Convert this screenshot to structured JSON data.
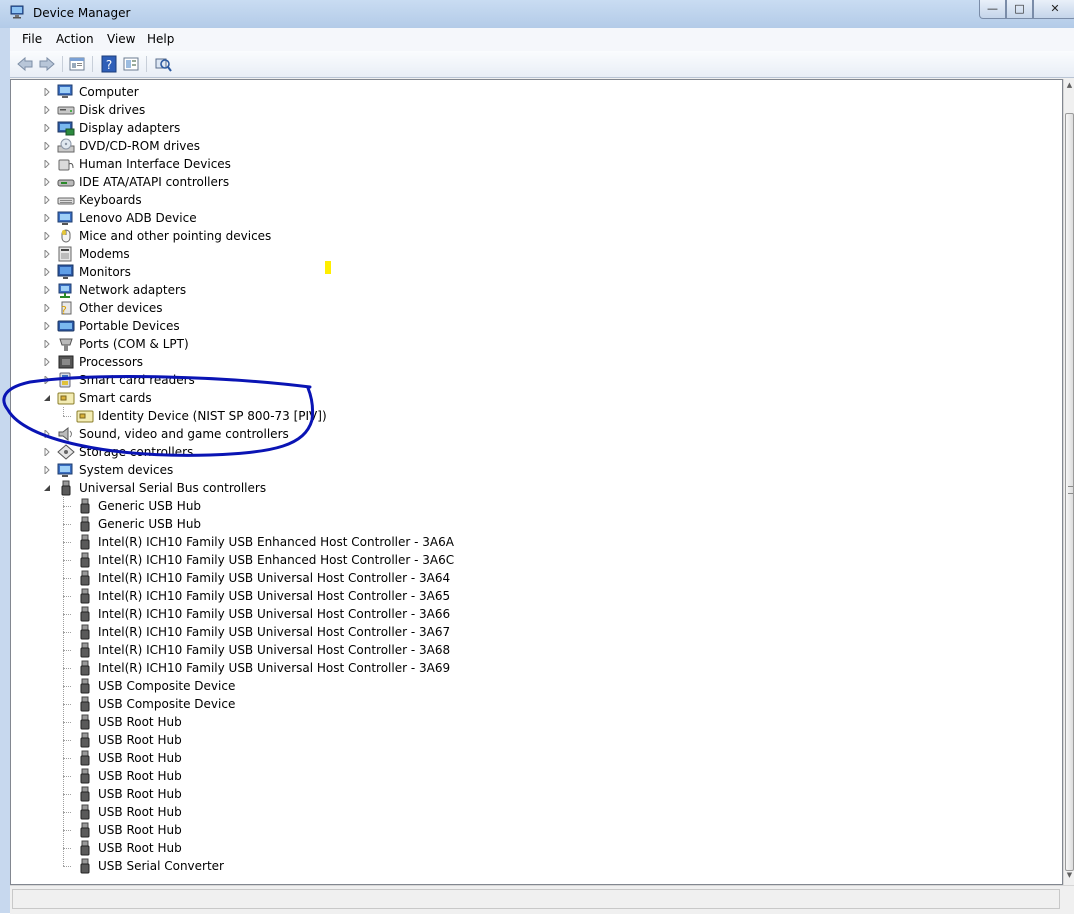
{
  "window": {
    "title": "Device Manager",
    "controls": {
      "minimize": "—",
      "maximize": "□",
      "close": "✕"
    }
  },
  "menu": [
    "File",
    "Action",
    "View",
    "Help"
  ],
  "toolbar": [
    "back-icon",
    "forward-icon",
    "properties-icon",
    "help-icon",
    "view-icon",
    "scan-hardware-icon"
  ],
  "tree": {
    "categories": [
      {
        "label": "Computer",
        "icon": "computer-icon",
        "expanded": false
      },
      {
        "label": "Disk drives",
        "icon": "disk-drive-icon",
        "expanded": false
      },
      {
        "label": "Display adapters",
        "icon": "display-adapter-icon",
        "expanded": false
      },
      {
        "label": "DVD/CD-ROM drives",
        "icon": "dvd-icon",
        "expanded": false
      },
      {
        "label": "Human Interface Devices",
        "icon": "hid-icon",
        "expanded": false
      },
      {
        "label": "IDE ATA/ATAPI controllers",
        "icon": "ide-controller-icon",
        "expanded": false
      },
      {
        "label": "Keyboards",
        "icon": "keyboard-icon",
        "expanded": false
      },
      {
        "label": "Lenovo ADB Device",
        "icon": "adb-device-icon",
        "expanded": false
      },
      {
        "label": "Mice and other pointing devices",
        "icon": "mouse-icon",
        "expanded": false
      },
      {
        "label": "Modems",
        "icon": "modem-icon",
        "expanded": false
      },
      {
        "label": "Monitors",
        "icon": "monitor-icon",
        "expanded": false
      },
      {
        "label": "Network adapters",
        "icon": "network-adapter-icon",
        "expanded": false
      },
      {
        "label": "Other devices",
        "icon": "other-device-icon",
        "expanded": false
      },
      {
        "label": "Portable Devices",
        "icon": "portable-device-icon",
        "expanded": false
      },
      {
        "label": "Ports (COM & LPT)",
        "icon": "port-icon",
        "expanded": false
      },
      {
        "label": "Processors",
        "icon": "processor-icon",
        "expanded": false
      },
      {
        "label": "Smart card readers",
        "icon": "smart-card-reader-icon",
        "expanded": false
      },
      {
        "label": "Smart cards",
        "icon": "smart-card-icon",
        "expanded": true,
        "children": [
          "Identity Device (NIST SP 800-73 [PIV])"
        ]
      },
      {
        "label": "Sound, video and game controllers",
        "icon": "sound-icon",
        "expanded": false
      },
      {
        "label": "Storage controllers",
        "icon": "storage-controller-icon",
        "expanded": false
      },
      {
        "label": "System devices",
        "icon": "system-device-icon",
        "expanded": false
      },
      {
        "label": "Universal Serial Bus controllers",
        "icon": "usb-icon",
        "expanded": true,
        "children": [
          "Generic USB Hub",
          "Generic USB Hub",
          "Intel(R) ICH10 Family USB Enhanced Host Controller - 3A6A",
          "Intel(R) ICH10 Family USB Enhanced Host Controller - 3A6C",
          "Intel(R) ICH10 Family USB Universal Host Controller - 3A64",
          "Intel(R) ICH10 Family USB Universal Host Controller - 3A65",
          "Intel(R) ICH10 Family USB Universal Host Controller - 3A66",
          "Intel(R) ICH10 Family USB Universal Host Controller - 3A67",
          "Intel(R) ICH10 Family USB Universal Host Controller - 3A68",
          "Intel(R) ICH10 Family USB Universal Host Controller - 3A69",
          "USB Composite Device",
          "USB Composite Device",
          "USB Root Hub",
          "USB Root Hub",
          "USB Root Hub",
          "USB Root Hub",
          "USB Root Hub",
          "USB Root Hub",
          "USB Root Hub",
          "USB Root Hub",
          "USB Serial Converter"
        ]
      }
    ]
  },
  "annotation": {
    "color": "#0a14b4",
    "marker_color": "#ffee00"
  }
}
